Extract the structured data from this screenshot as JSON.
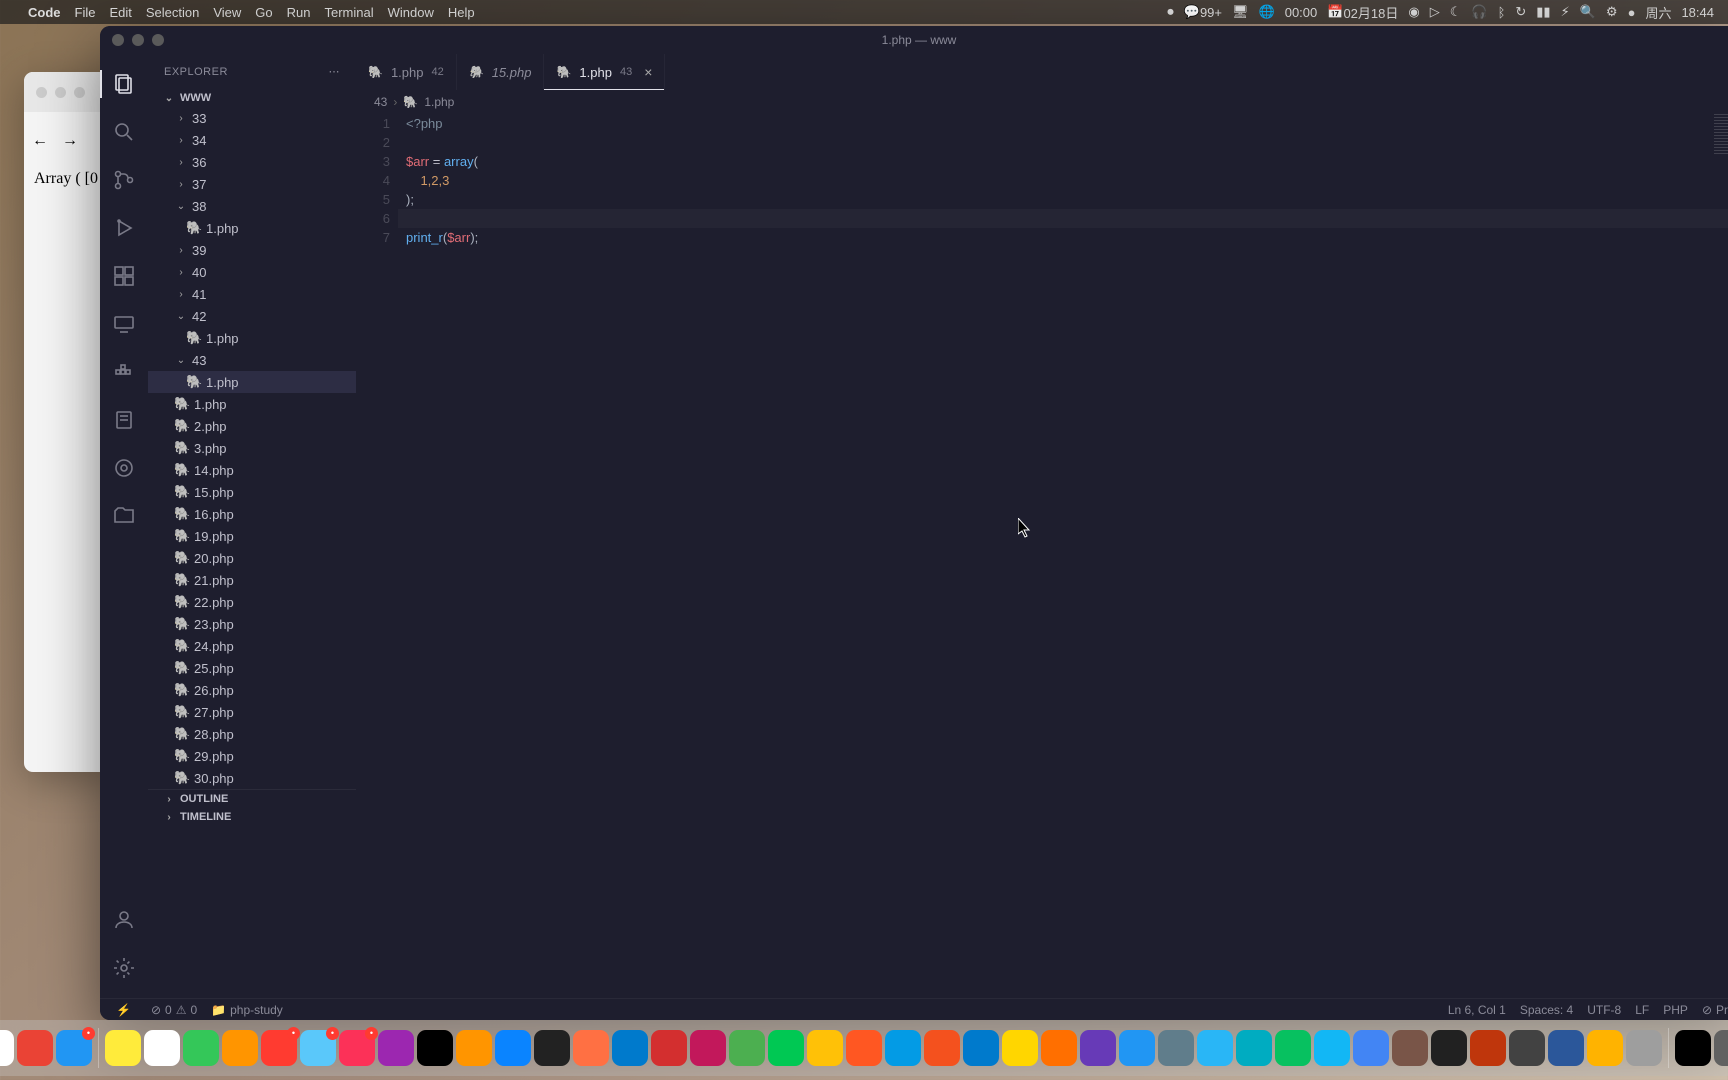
{
  "menubar": {
    "app": "Code",
    "items": [
      "File",
      "Edit",
      "Selection",
      "View",
      "Go",
      "Run",
      "Terminal",
      "Window",
      "Help"
    ],
    "right": {
      "wechat_badge": "99+",
      "timer": "00:00",
      "date": "02月18日",
      "battery": "",
      "day": "周六",
      "time": "18:44"
    }
  },
  "browser": {
    "content_text": "Array ( [0"
  },
  "vscode": {
    "title": "1.php — www",
    "explorer_label": "EXPLORER",
    "workspace": "WWW",
    "folders": {
      "f33": "33",
      "f34": "34",
      "f36": "36",
      "f37": "37",
      "f38": "38",
      "f38_1php": "1.php",
      "f39": "39",
      "f40": "40",
      "f41": "41",
      "f42": "42",
      "f42_1php": "1.php",
      "f43": "43",
      "f43_1php": "1.php",
      "root_files": [
        "1.php",
        "2.php",
        "3.php",
        "14.php",
        "15.php",
        "16.php",
        "19.php",
        "20.php",
        "21.php",
        "22.php",
        "23.php",
        "24.php",
        "25.php",
        "26.php",
        "27.php",
        "28.php",
        "29.php",
        "30.php"
      ]
    },
    "outline": "OUTLINE",
    "timeline": "TIMELINE",
    "tabs": [
      {
        "icon": "php",
        "label": "1.php",
        "badge": "42",
        "active": false,
        "italic": false
      },
      {
        "icon": "php",
        "label": "15.php",
        "badge": "",
        "active": false,
        "italic": true
      },
      {
        "icon": "php",
        "label": "1.php",
        "badge": "43",
        "active": true,
        "italic": false
      }
    ],
    "breadcrumb": {
      "root": "43",
      "file": "1.php"
    },
    "code": {
      "l1": "<?php",
      "l3a": "$arr",
      "l3b": " = ",
      "l3c": "array",
      "l3d": "(",
      "l4": "    1,2,3",
      "l5": ");",
      "l7a": "print_r",
      "l7b": "(",
      "l7c": "$arr",
      "l7d": ");"
    },
    "status": {
      "errors": "0",
      "warnings": "0",
      "folder": "php-study",
      "pos": "Ln 6, Col 1",
      "spaces": "Spaces: 4",
      "enc": "UTF-8",
      "eol": "LF",
      "lang": "PHP",
      "pret": "Pr"
    }
  },
  "dock": {
    "items": [
      "finder",
      "launchpad",
      "apps",
      "chrome",
      "mail",
      "notes",
      "cal",
      "weather",
      "photos",
      "reminders",
      "messages",
      "music",
      "podcasts",
      "tv",
      "books",
      "store",
      "terminal",
      "firefox",
      "vscode-alt",
      "red-app",
      "red-app2",
      "green",
      "play",
      "camera",
      "opera",
      "safari",
      "brave",
      "code",
      "lightning",
      "orange",
      "arc",
      "z",
      "clock",
      "send",
      "global",
      "wechat",
      "qq",
      "map",
      "media",
      "dark",
      "kobo",
      "dark2",
      "word",
      "shield",
      "vpn",
      "black",
      "trash",
      "grey",
      "doc"
    ]
  }
}
